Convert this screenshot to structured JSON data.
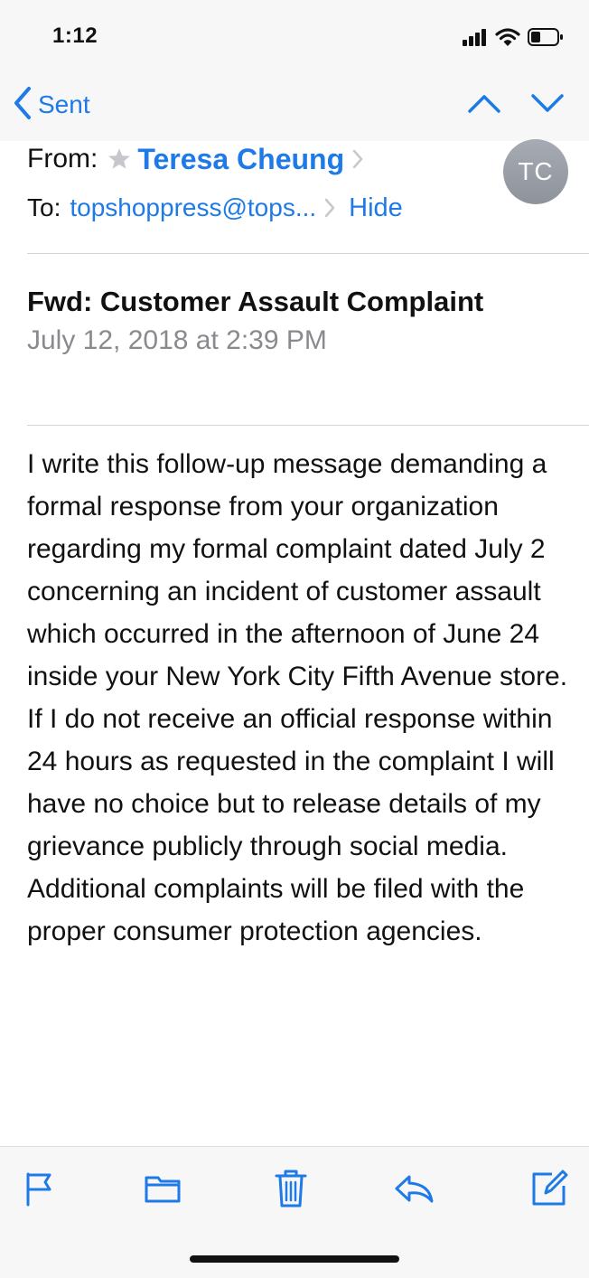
{
  "status_bar": {
    "time": "1:12",
    "icons": [
      "cellular-signal-icon",
      "wifi-icon",
      "battery-icon"
    ]
  },
  "nav": {
    "back_label": "Sent",
    "back_icon": "chevron-left-icon",
    "prev_icon": "chevron-up-icon",
    "next_icon": "chevron-down-icon"
  },
  "header": {
    "from_label": "From:",
    "sender_name": "Teresa Cheung",
    "to_label": "To:",
    "recipient": "topshoppress@tops...",
    "hide_label": "Hide",
    "avatar_initials": "TC"
  },
  "message": {
    "subject": "Fwd: Customer Assault Complaint",
    "date": "July 12, 2018 at 2:39 PM",
    "body": "I write this follow-up message demanding a formal response from your organization regarding my formal complaint dated July 2 concerning an incident of customer assault which occurred in the afternoon of June 24 inside your New York City Fifth Avenue store.  If I do not receive an official response within 24 hours as requested in the complaint I will have no choice but to release details of my grievance publicly through social media.  Additional complaints will be filed with the proper consumer protection agencies."
  },
  "toolbar": {
    "icons": [
      "flag-icon",
      "folder-icon",
      "trash-icon",
      "reply-icon",
      "compose-icon"
    ]
  },
  "colors": {
    "accent": "#1e7ae6",
    "secondary_text": "#8a8a8e",
    "bar_background": "#f7f7f7",
    "avatar": "#9a9ea6"
  }
}
